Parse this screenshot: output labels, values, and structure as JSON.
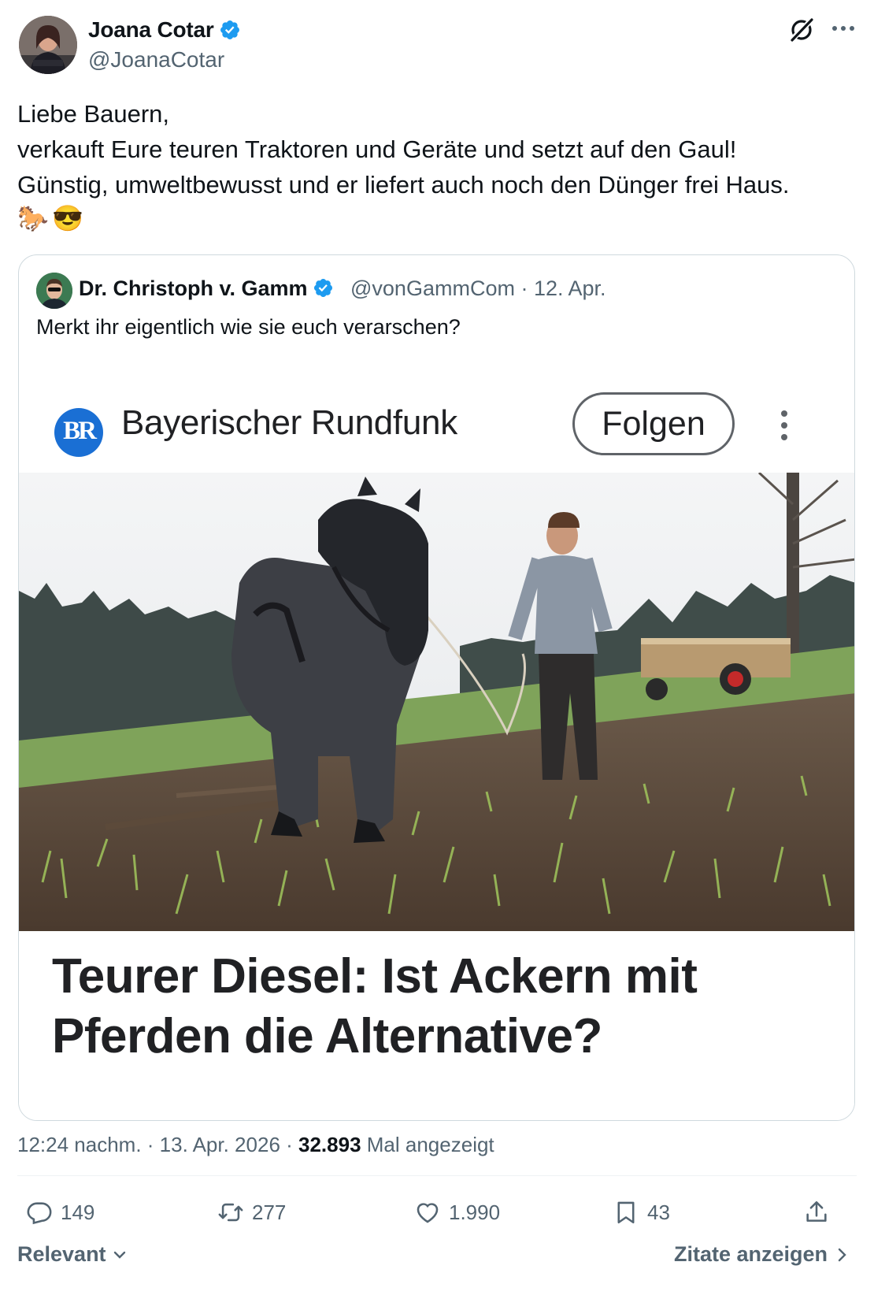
{
  "author": {
    "name": "Joana Cotar",
    "handle": "@JoanaCotar",
    "verified_color": "#1d9bf0"
  },
  "tweet": {
    "lines": [
      "Liebe Bauern,",
      "verkauft Eure teuren Traktoren und Geräte und setzt auf den Gaul!",
      "Günstig, umweltbewusst und er liefert auch noch den Dünger frei Haus."
    ],
    "emojis": [
      "🐎",
      "😎"
    ]
  },
  "quoted": {
    "name": "Dr. Christoph v. Gamm",
    "handle_date": "@vonGammCom · 12. Apr.",
    "text": "Merkt ihr eigentlich wie sie euch verarschen?",
    "media": {
      "publisher": "Bayerischer Rundfunk",
      "logo_text": "BR",
      "follow_label": "Folgen",
      "headline_lines": [
        "Teurer Diesel: Ist Ackern mit",
        "Pferden die Alternative?"
      ],
      "logo_color": "#1a6fd4"
    }
  },
  "meta": {
    "time_date": "12:24 nachm. · 13. Apr. 2026 · ",
    "views": "32.893",
    "views_label": " Mal angezeigt"
  },
  "actions": {
    "replies": "149",
    "retweets": "277",
    "likes": "1.990",
    "bookmarks": "43"
  },
  "footer": {
    "sort_label": "Relevant",
    "quotes_label": "Zitate anzeigen"
  }
}
